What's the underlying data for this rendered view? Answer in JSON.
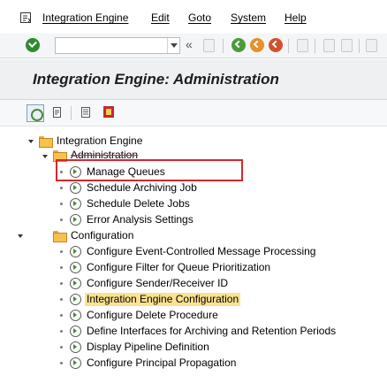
{
  "menu": {
    "items": [
      "Integration Engine",
      "Edit",
      "Goto",
      "System",
      "Help"
    ]
  },
  "toolbar": {
    "command_value": "",
    "double_arrow": "«"
  },
  "title": "Integration Engine: Administration",
  "colors": {
    "check_green": "#2f8a2f",
    "highlight": "#fbe28f",
    "selection_red": "#d7262d",
    "folder": "#f5c34d"
  },
  "tree": {
    "root": "Integration Engine",
    "administration": {
      "label": "Administration",
      "items": [
        "Manage Queues",
        "Schedule Archiving Job",
        "Schedule Delete Jobs",
        "Error Analysis Settings"
      ]
    },
    "configuration": {
      "label": "Configuration",
      "items": [
        "Configure Event-Controlled Message Processing",
        "Configure Filter for Queue Prioritization",
        "Configure Sender/Receiver ID",
        "Integration Engine Configuration",
        "Configure Delete Procedure",
        "Define Interfaces for Archiving and Retention Periods",
        "Display Pipeline Definition",
        "Configure Principal Propagation"
      ]
    }
  }
}
